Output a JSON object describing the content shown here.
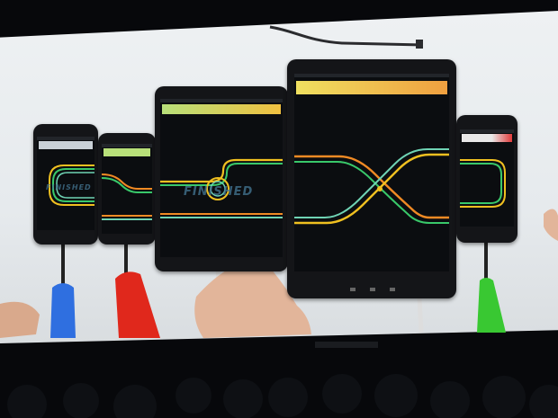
{
  "scene": {
    "description_tag": "stage-projection",
    "devices": [
      {
        "id": "phone-1",
        "label": "FINISHED"
      },
      {
        "id": "phone-2"
      },
      {
        "id": "tablet-small",
        "label": "FINISHED"
      },
      {
        "id": "tablet-large"
      },
      {
        "id": "phone-3"
      }
    ]
  },
  "colors": {
    "track_yellow": "#f0c020",
    "track_green": "#39c86a",
    "track_orange": "#f08a24",
    "track_teal": "#6fd3b4",
    "cable_blue": "#2f6fe0",
    "cable_red": "#e0281c",
    "cable_green": "#39c832",
    "hud_green": "#b8e07a",
    "hud_orange": "#f0a040"
  }
}
